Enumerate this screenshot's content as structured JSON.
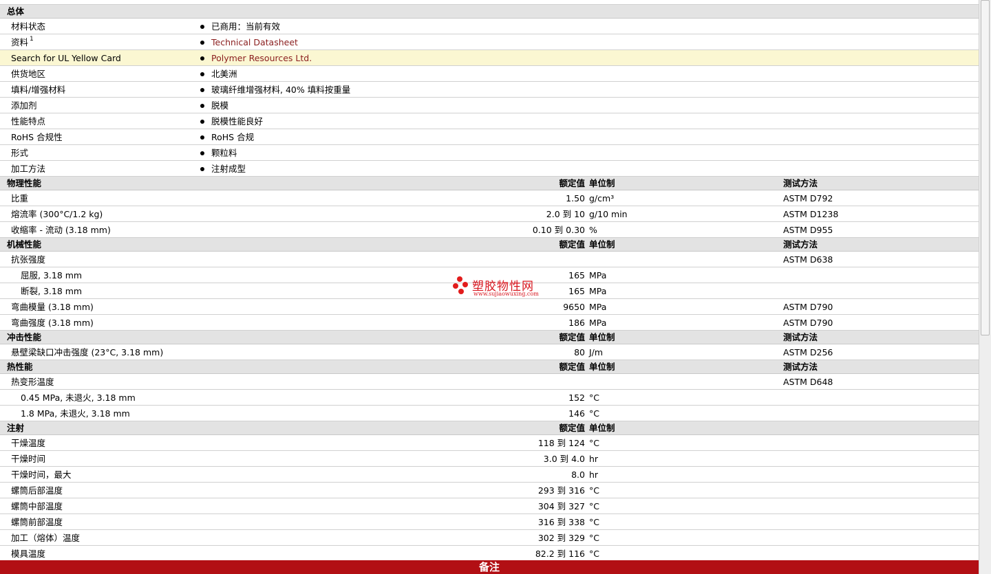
{
  "sections": [
    {
      "title": "总体",
      "kind": "general",
      "rows": [
        {
          "label": "材料状态",
          "value": "已商用：当前有效"
        },
        {
          "label": "资料",
          "sup": "1",
          "value": "Technical Datasheet",
          "link": true
        },
        {
          "label": "Search for UL Yellow Card",
          "value": "Polymer Resources Ltd.",
          "link": true,
          "highlight": true
        },
        {
          "label": "供货地区",
          "value": "北美洲"
        },
        {
          "label": "填料/增强材料",
          "value": "玻璃纤维增强材料, 40% 填料按重量"
        },
        {
          "label": "添加剂",
          "value": "脱模"
        },
        {
          "label": "性能特点",
          "value": "脱模性能良好"
        },
        {
          "label": "RoHS 合规性",
          "value": "RoHS 合规"
        },
        {
          "label": "形式",
          "value": "颗粒料"
        },
        {
          "label": "加工方法",
          "value": "注射成型"
        }
      ]
    },
    {
      "title": "物理性能",
      "kind": "prop",
      "col_value": "额定值",
      "col_unit": "单位制",
      "col_test": "测试方法",
      "rows": [
        {
          "label": "比重",
          "value": "1.50",
          "unit": "g/cm³",
          "test": "ASTM D792"
        },
        {
          "label": "熔流率  (300°C/1.2 kg)",
          "value": "2.0 到  10",
          "unit": "g/10 min",
          "test": "ASTM D1238"
        },
        {
          "label": "收缩率  - 流动  (3.18 mm)",
          "value": "0.10 到  0.30",
          "unit": "%",
          "test": "ASTM D955"
        }
      ]
    },
    {
      "title": "机械性能",
      "kind": "prop",
      "col_value": "额定值",
      "col_unit": "单位制",
      "col_test": "测试方法",
      "rows": [
        {
          "label": "抗张强度",
          "value": "",
          "unit": "",
          "test": "ASTM D638"
        },
        {
          "label": "屈服, 3.18 mm",
          "value": "165",
          "unit": "MPa",
          "test": "",
          "indent": true
        },
        {
          "label": "断裂, 3.18 mm",
          "value": "165",
          "unit": "MPa",
          "test": "",
          "indent": true
        },
        {
          "label": "弯曲模量  (3.18 mm)",
          "value": "9650",
          "unit": "MPa",
          "test": "ASTM D790"
        },
        {
          "label": "弯曲强度  (3.18 mm)",
          "value": "186",
          "unit": "MPa",
          "test": "ASTM D790"
        }
      ]
    },
    {
      "title": "冲击性能",
      "kind": "prop",
      "col_value": "额定值",
      "col_unit": "单位制",
      "col_test": "测试方法",
      "rows": [
        {
          "label": "悬壁梁缺口冲击强度  (23°C, 3.18 mm)",
          "value": "80",
          "unit": "J/m",
          "test": "ASTM D256"
        }
      ]
    },
    {
      "title": "热性能",
      "kind": "prop",
      "col_value": "额定值",
      "col_unit": "单位制",
      "col_test": "测试方法",
      "rows": [
        {
          "label": "热变形温度",
          "value": "",
          "unit": "",
          "test": "ASTM D648"
        },
        {
          "label": "0.45 MPa, 未退火, 3.18 mm",
          "value": "152",
          "unit": "°C",
          "test": "",
          "indent": true
        },
        {
          "label": "1.8 MPa, 未退火, 3.18 mm",
          "value": "146",
          "unit": "°C",
          "test": "",
          "indent": true
        }
      ]
    },
    {
      "title": "注射",
      "kind": "prop",
      "col_value": "额定值",
      "col_unit": "单位制",
      "col_test": "",
      "rows": [
        {
          "label": "干燥温度",
          "value": "118 到  124",
          "unit": "°C",
          "test": ""
        },
        {
          "label": "干燥时间",
          "value": "3.0 到  4.0",
          "unit": "hr",
          "test": ""
        },
        {
          "label": "干燥时间，最大",
          "value": "8.0",
          "unit": "hr",
          "test": ""
        },
        {
          "label": "螺筒后部温度",
          "value": "293 到  316",
          "unit": "°C",
          "test": ""
        },
        {
          "label": "螺筒中部温度",
          "value": "304 到  327",
          "unit": "°C",
          "test": ""
        },
        {
          "label": "螺筒前部温度",
          "value": "316 到  338",
          "unit": "°C",
          "test": ""
        },
        {
          "label": "加工（熔体）温度",
          "value": "302 到  329",
          "unit": "°C",
          "test": ""
        },
        {
          "label": "模具温度",
          "value": "82.2 到  116",
          "unit": "°C",
          "test": ""
        }
      ]
    }
  ],
  "footer": {
    "title": "备注"
  },
  "watermark": {
    "brand": "塑胶物性网",
    "url": "www.sujiaowuxing.com"
  },
  "colors": {
    "link": "#8a1d1d",
    "footer": "#b20f14",
    "highlight": "#fbf7d2"
  }
}
